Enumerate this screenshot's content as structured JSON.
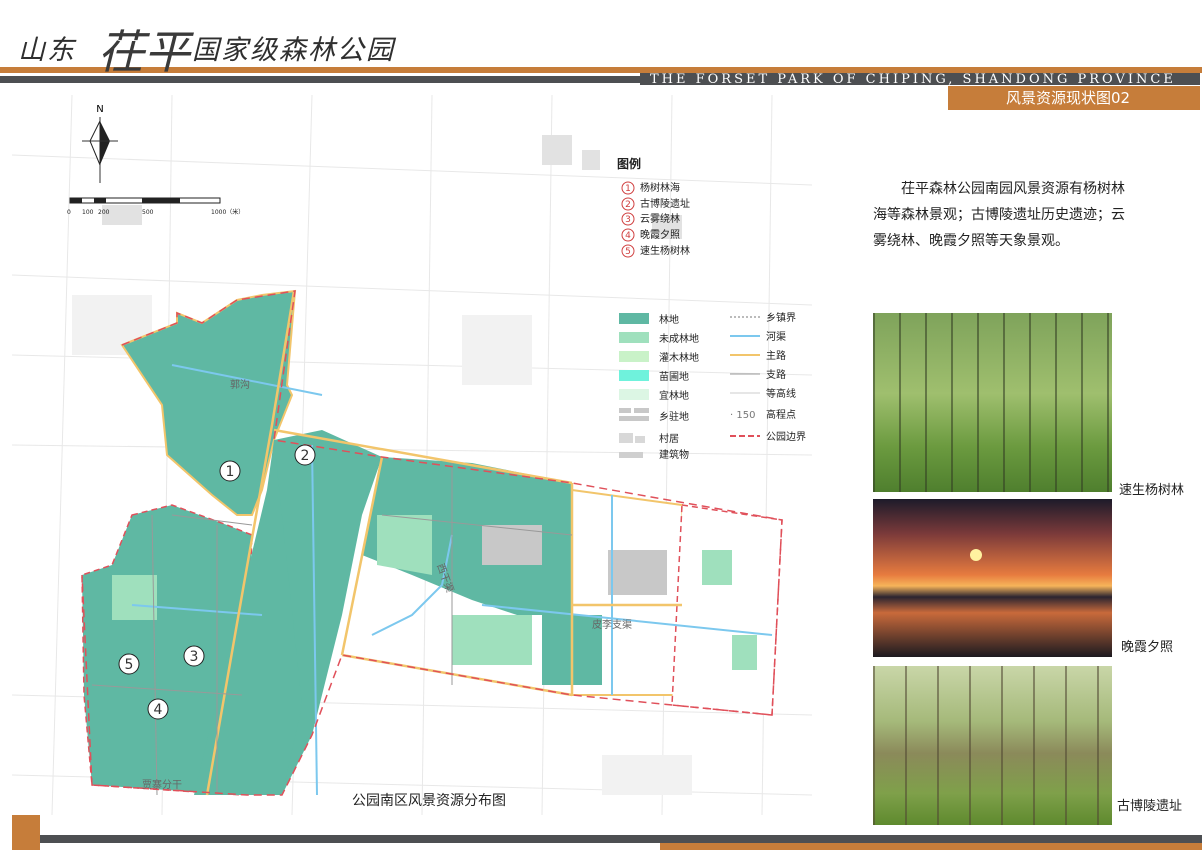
{
  "header": {
    "brand_prefix": "山东",
    "brand_main": "茌平",
    "brand_suffix": "国家级森林公园",
    "subtitle_en": "THE FORSET PARK OF CHIPING, SHANDONG PROVINCE",
    "page_tag": "风景资源现状图02"
  },
  "map": {
    "north": "N",
    "scale_labels": [
      "0",
      "100",
      "200",
      "500",
      "1000（米）"
    ],
    "caption": "公园南区风景资源分布图",
    "road_labels": [
      "郭沟",
      "贾寨分干",
      "皮李支渠",
      "西干渠"
    ],
    "markers": [
      "1",
      "2",
      "3",
      "4",
      "5"
    ],
    "legend_title": "图例",
    "sites": [
      {
        "num": "1",
        "label": "杨树林海"
      },
      {
        "num": "2",
        "label": "古博陵遗址"
      },
      {
        "num": "3",
        "label": "云雾绕林"
      },
      {
        "num": "4",
        "label": "晚霞夕照"
      },
      {
        "num": "5",
        "label": "速生杨树林"
      }
    ],
    "legend_fill": [
      {
        "label": "林地",
        "color": "#5fb8a3"
      },
      {
        "label": "未成林地",
        "color": "#9fe0bd"
      },
      {
        "label": "灌木林地",
        "color": "#c9f2c8"
      },
      {
        "label": "苗圃地",
        "color": "#6ff2dc"
      },
      {
        "label": "宜林地",
        "color": "#dcf6e4"
      },
      {
        "label": "乡驻地",
        "color": "#c8c8c8"
      },
      {
        "label": "村居",
        "color": "#d8d8d8"
      },
      {
        "label": "建筑物",
        "color": "#cfcfcf"
      }
    ],
    "legend_line": [
      {
        "label": "乡镇界",
        "color": "#777777"
      },
      {
        "label": "河渠",
        "color": "#7cc8ee"
      },
      {
        "label": "主路",
        "color": "#f2c56b"
      },
      {
        "label": "支路",
        "color": "#999999"
      },
      {
        "label": "等高线",
        "color": "#cccccc"
      },
      {
        "label": "高程点",
        "prefix": "· 150"
      },
      {
        "label": "公园边界",
        "color": "#e0505a"
      }
    ]
  },
  "description": "茌平森林公园南园风景资源有杨树林海等森林景观；古博陵遗址历史遗迹；云雾绕林、晚霞夕照等天象景观。",
  "photos": [
    {
      "caption": "速生杨树林"
    },
    {
      "caption": "晚霞夕照"
    },
    {
      "caption": "古博陵遗址"
    }
  ]
}
